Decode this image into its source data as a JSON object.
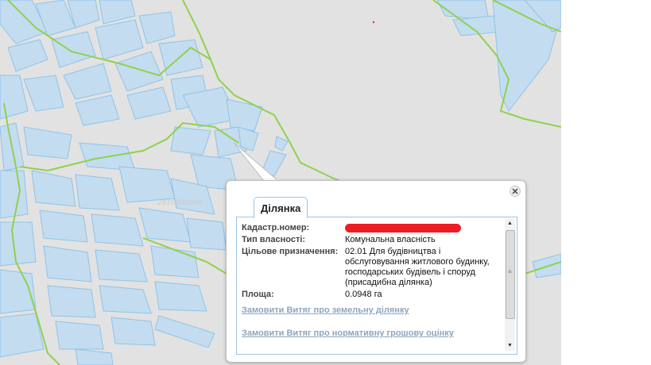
{
  "map": {
    "watermarks": [
      "2610900000",
      "2610900000",
      "2610900000"
    ]
  },
  "popup": {
    "tab_label": "Ділянка",
    "close_icon": "close-icon",
    "fields": [
      {
        "label": "Кадастр.номер:",
        "value": "",
        "redacted": true
      },
      {
        "label": "Тип власності:",
        "value": "Комунальна власність"
      },
      {
        "label": "Цільове призначення:",
        "value": "02.01 Для будівництва і обслуговування житлового будинку, господарських будівель і споруд (присадибна ділянка)"
      },
      {
        "label": "Площа:",
        "value": "0.0948 га"
      }
    ],
    "links": {
      "extract_land_plot": "Замовити Витяг про земельну ділянку",
      "extract_normative_valuation": "Замовити Витяг про нормативну грошову оцінку"
    }
  },
  "colors": {
    "map_background": "#e2e2e2",
    "parcel_fill": "#c4dcef",
    "parcel_stroke": "#8ec4e8",
    "boundary": "#8fd14f",
    "redaction": "#ee1d23",
    "link": "#8da6bd"
  }
}
